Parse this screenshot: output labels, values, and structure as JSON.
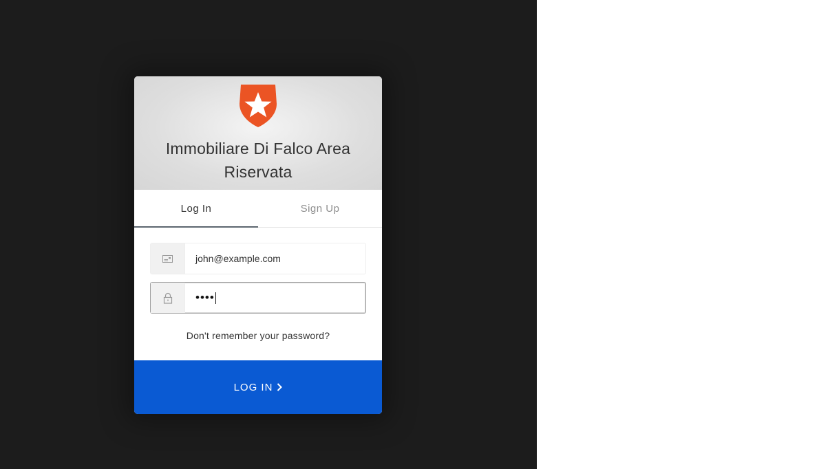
{
  "widget": {
    "app_title": "Immobiliare Di Falco Area Riservata",
    "logo_icon": "auth0-shield-star-icon",
    "brand_color": "#eb5424"
  },
  "tabs": [
    {
      "label": "Log In",
      "active": true
    },
    {
      "label": "Sign Up",
      "active": false
    }
  ],
  "form": {
    "email": {
      "icon": "envelope-icon",
      "value": "john@example.com"
    },
    "password": {
      "icon": "lock-icon",
      "value_masked": "••••"
    },
    "forgot_label": "Don't remember your password?"
  },
  "submit": {
    "label": "LOG IN",
    "icon": "chevron-right-icon",
    "color": "#0a5ad3"
  }
}
